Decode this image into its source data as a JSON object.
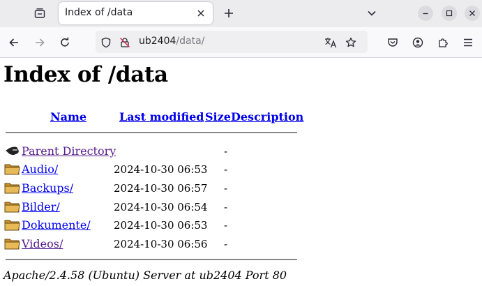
{
  "browser": {
    "tab": {
      "title": "Index of /data",
      "close_icon": "close-icon"
    },
    "new_tab_icon": "plus-icon",
    "url": {
      "host": "ub2404",
      "path": "/data/"
    }
  },
  "page": {
    "heading": "Index of /data",
    "columns": {
      "name": "Name",
      "last_modified": "Last modified",
      "size": "Size",
      "description": "Description"
    },
    "rows": [
      {
        "icon": "back-arrow-icon",
        "name": "Parent Directory",
        "modified": "",
        "size": "-"
      },
      {
        "icon": "folder-icon",
        "name": "Audio/",
        "modified": "2024-10-30 06:53",
        "size": "-"
      },
      {
        "icon": "folder-icon",
        "name": "Backups/",
        "modified": "2024-10-30 06:57",
        "size": "-"
      },
      {
        "icon": "folder-icon",
        "name": "Bilder/",
        "modified": "2024-10-30 06:54",
        "size": "-"
      },
      {
        "icon": "folder-icon",
        "name": "Dokumente/",
        "modified": "2024-10-30 06:53",
        "size": "-"
      },
      {
        "icon": "folder-icon",
        "name": "Videos/",
        "modified": "2024-10-30 06:56",
        "size": "-"
      }
    ],
    "address": "Apache/2.4.58 (Ubuntu) Server at ub2404 Port 80"
  },
  "colors": {
    "link": "#0000ee",
    "visited_link": "#551a8b",
    "folder": "#e0b24a"
  }
}
